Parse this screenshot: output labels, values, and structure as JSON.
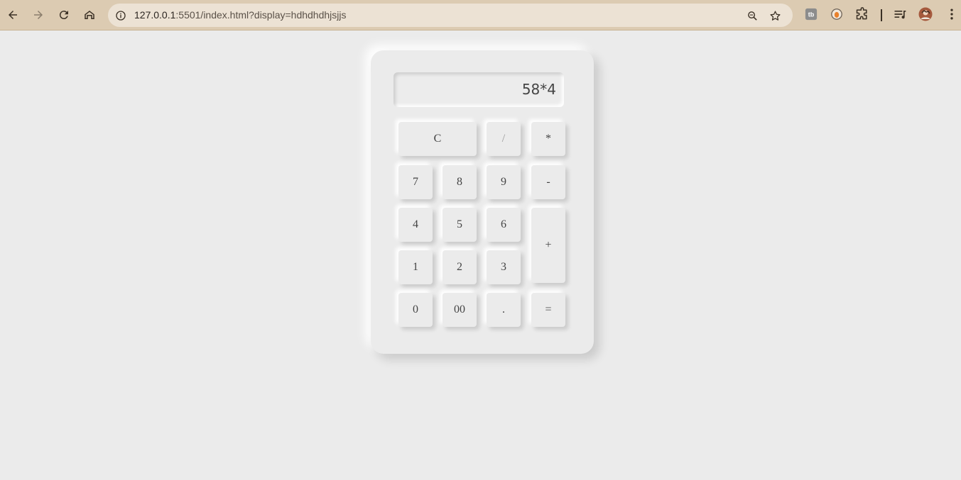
{
  "browser": {
    "url_host": "127.0.0.1",
    "url_path": ":5501/index.html?display=hdhdhdhjsjjs",
    "icons": [
      "back-icon",
      "forward-icon",
      "reload-icon",
      "home-icon",
      "site-info-icon",
      "zoom-icon",
      "bookmark-star-icon",
      "extension-icon",
      "extension-icon",
      "puzzle-icon",
      "media-control-icon",
      "avatar",
      "menu-icon"
    ]
  },
  "calculator": {
    "display": "58*4",
    "keys": {
      "clear": "C",
      "divide": "/",
      "multiply": "*",
      "seven": "7",
      "eight": "8",
      "nine": "9",
      "minus": "-",
      "four": "4",
      "five": "5",
      "six": "6",
      "plus": "+",
      "one": "1",
      "two": "2",
      "three": "3",
      "zero": "0",
      "double_zero": "00",
      "dot": ".",
      "equals": "="
    }
  },
  "colors": {
    "toolbar": "#dccbb2",
    "omnibox": "#ece2d4",
    "page_background": "#ebebeb"
  }
}
